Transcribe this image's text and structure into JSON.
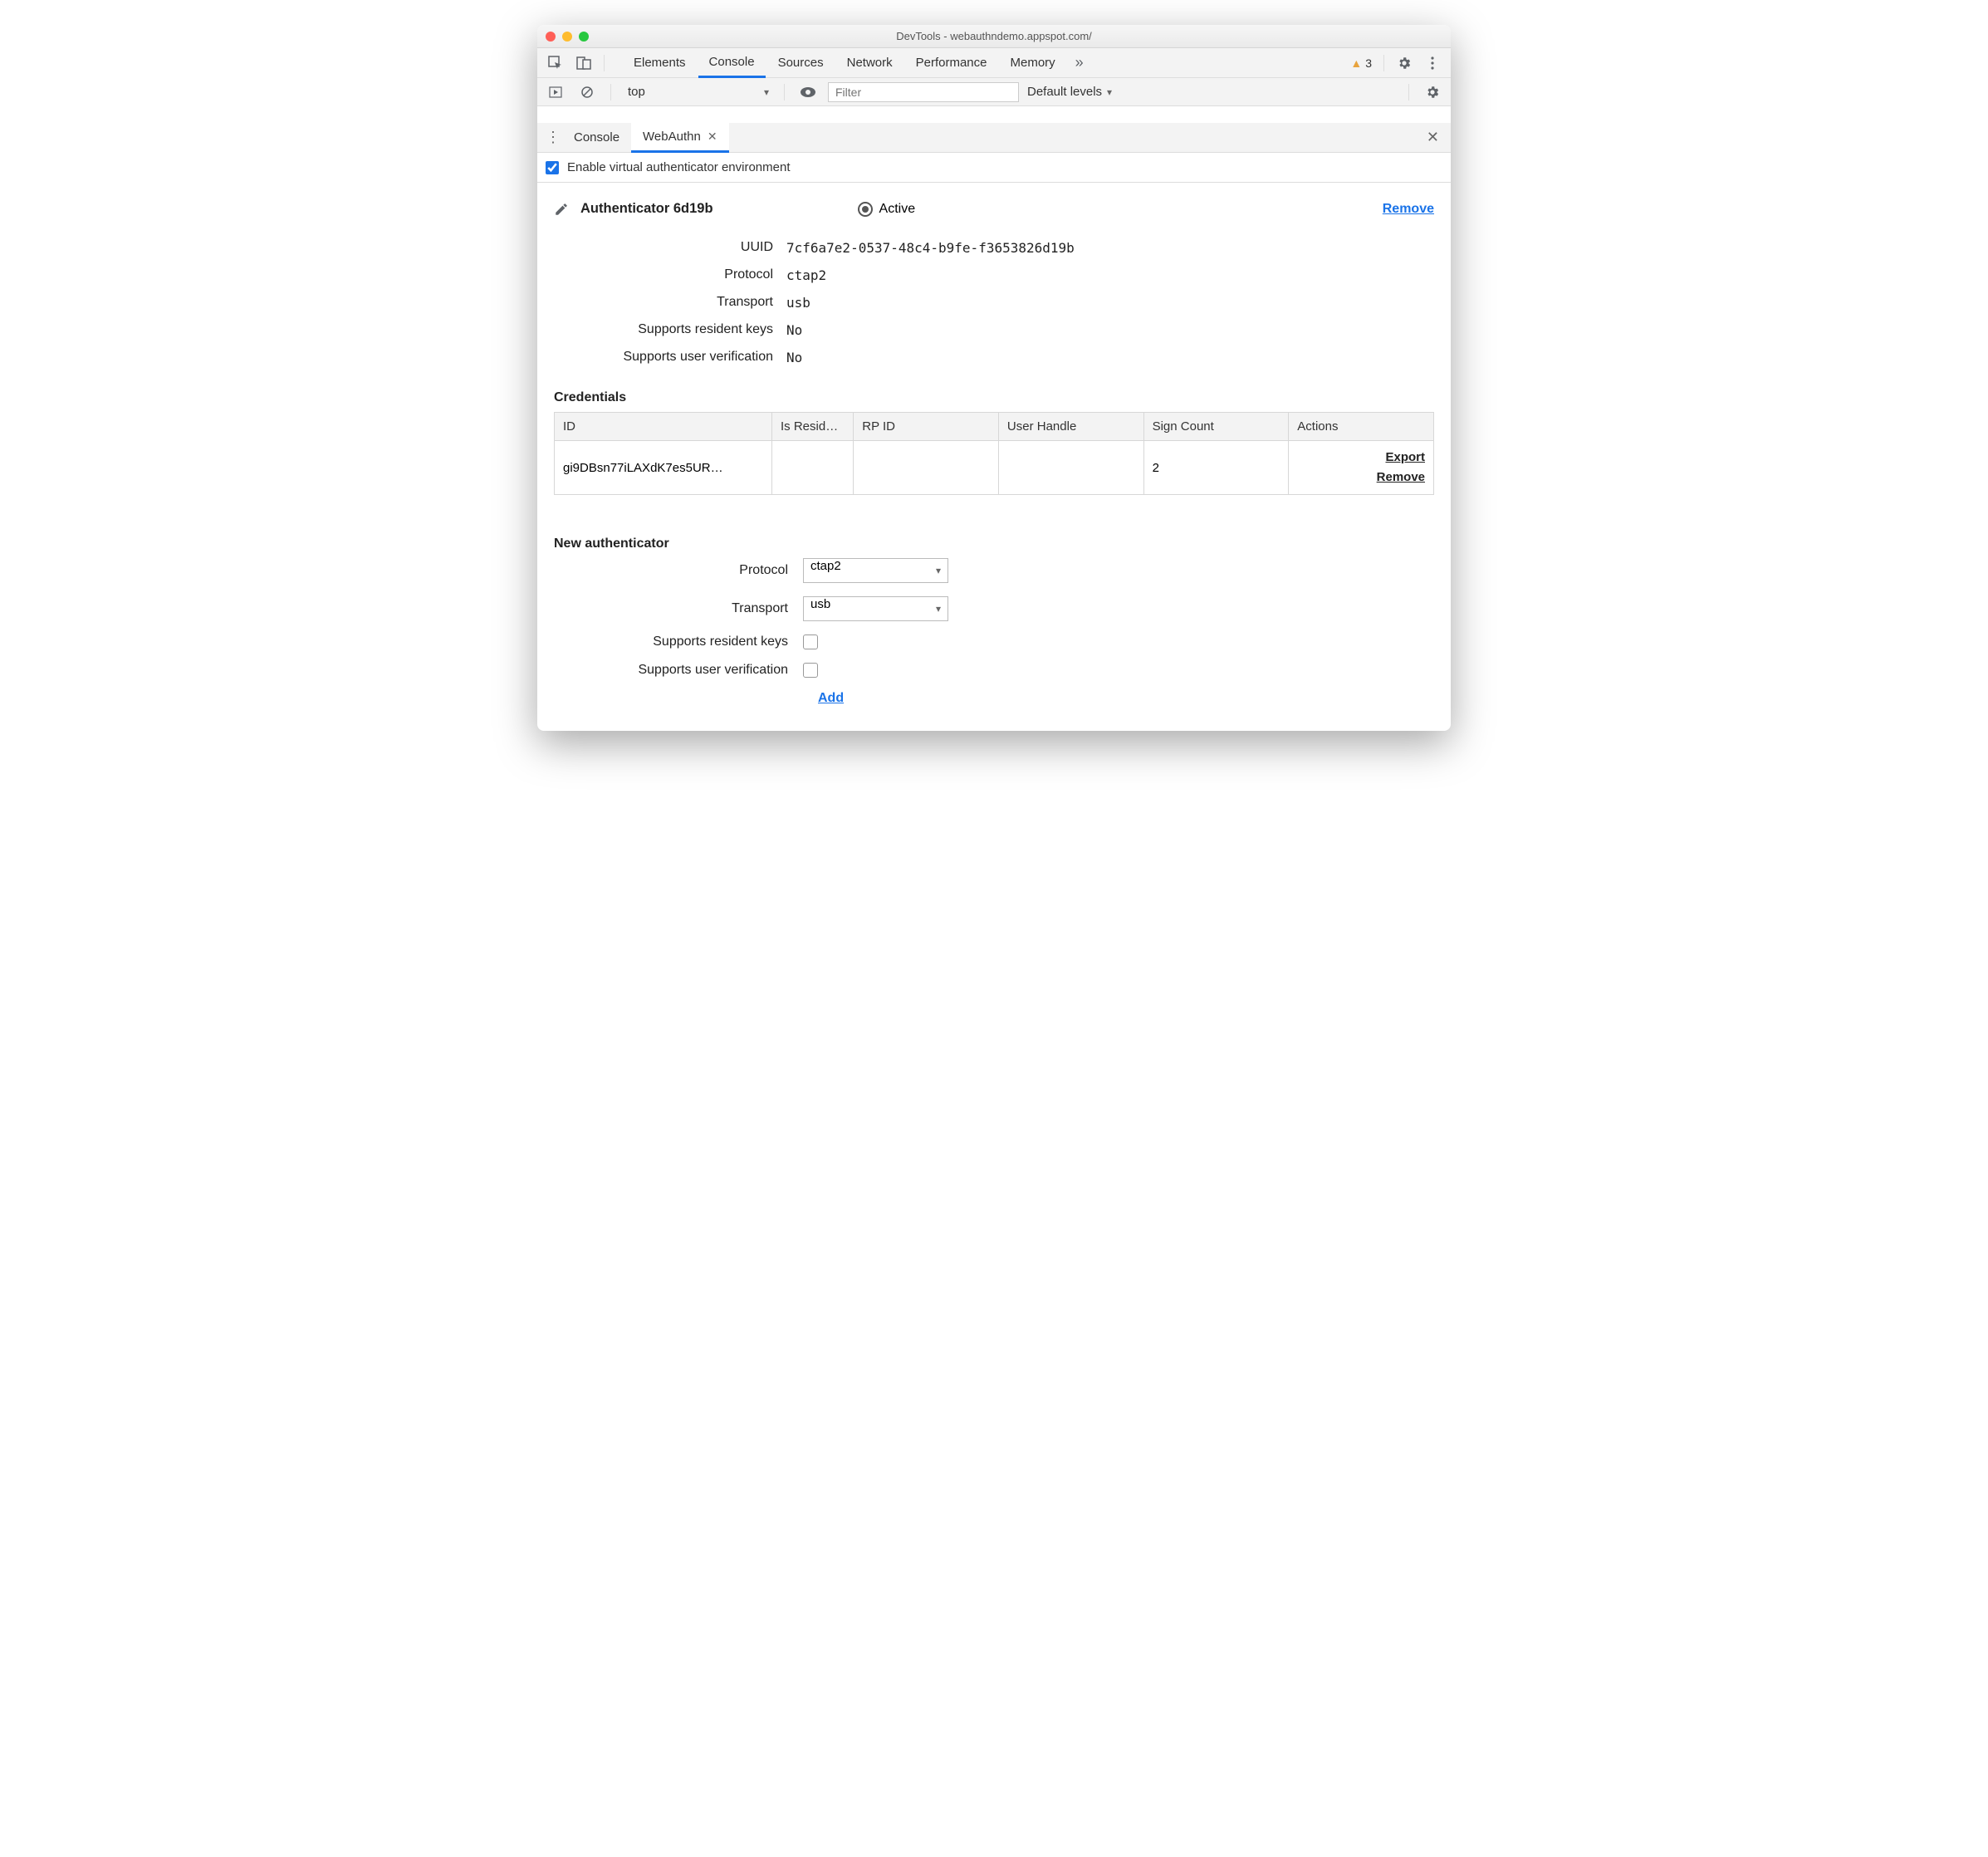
{
  "window": {
    "title": "DevTools - webauthndemo.appspot.com/"
  },
  "tabs": [
    "Elements",
    "Console",
    "Sources",
    "Network",
    "Performance",
    "Memory"
  ],
  "active_tab": "Console",
  "warning_count": "3",
  "console_bar": {
    "context": "top",
    "filter_placeholder": "Filter",
    "levels": "Default levels"
  },
  "drawer": {
    "tabs": [
      "Console",
      "WebAuthn"
    ],
    "active": "WebAuthn",
    "enable_label": "Enable virtual authenticator environment"
  },
  "authenticator": {
    "title": "Authenticator 6d19b",
    "active_label": "Active",
    "remove_label": "Remove",
    "fields": {
      "uuid_label": "UUID",
      "uuid_value": "7cf6a7e2-0537-48c4-b9fe-f3653826d19b",
      "protocol_label": "Protocol",
      "protocol_value": "ctap2",
      "transport_label": "Transport",
      "transport_value": "usb",
      "resident_label": "Supports resident keys",
      "resident_value": "No",
      "userver_label": "Supports user verification",
      "userver_value": "No"
    }
  },
  "credentials": {
    "title": "Credentials",
    "headers": [
      "ID",
      "Is Resid…",
      "RP ID",
      "User Handle",
      "Sign Count",
      "Actions"
    ],
    "row": {
      "id": "gi9DBsn77iLAXdK7es5UR…",
      "is_resident": "",
      "rp_id": "",
      "user_handle": "",
      "sign_count": "2",
      "export": "Export",
      "remove": "Remove"
    }
  },
  "new_auth": {
    "title": "New authenticator",
    "protocol_label": "Protocol",
    "protocol_value": "ctap2",
    "transport_label": "Transport",
    "transport_value": "usb",
    "resident_label": "Supports resident keys",
    "userver_label": "Supports user verification",
    "add_label": "Add"
  }
}
